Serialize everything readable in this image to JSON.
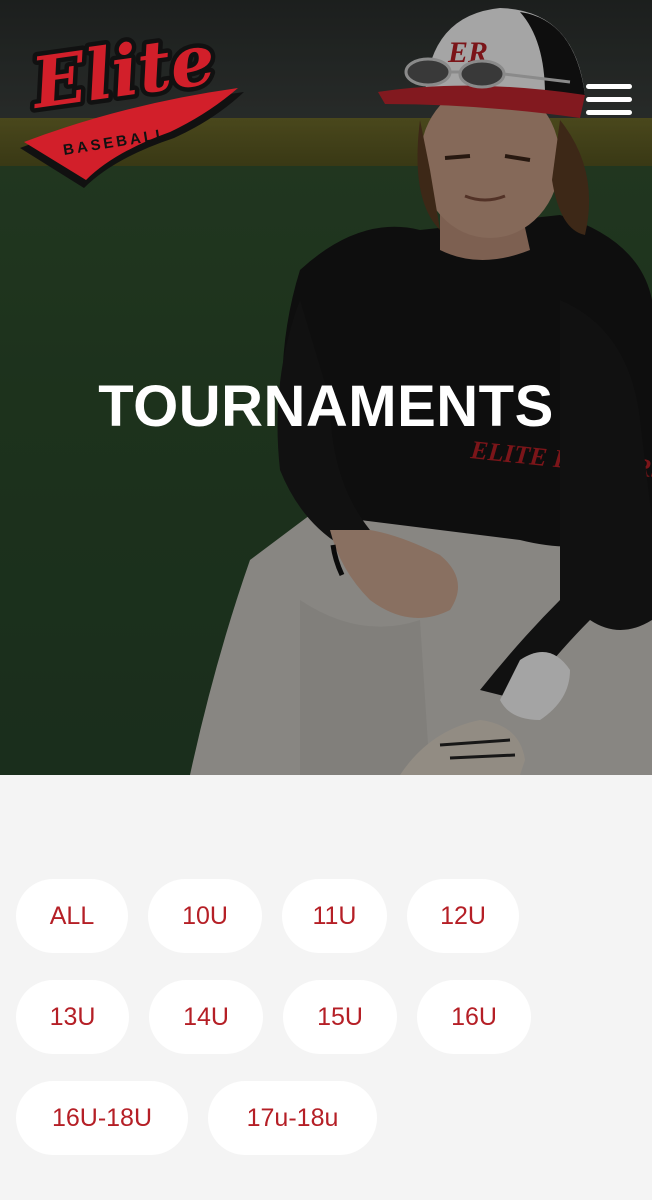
{
  "brand": {
    "logo_script": "Elite",
    "logo_banner": "BASEBALL",
    "cap_monogram": "ER",
    "colors": {
      "red": "#d21f2a",
      "dark_red": "#b51f26",
      "black": "#111111",
      "background": "#f4f4f4"
    }
  },
  "header": {
    "menu_icon": "hamburger-menu-icon"
  },
  "hero": {
    "title": "TOURNAMENTS"
  },
  "filters": {
    "items": [
      {
        "label": "ALL"
      },
      {
        "label": "10U"
      },
      {
        "label": "11U"
      },
      {
        "label": "12U"
      },
      {
        "label": "13U"
      },
      {
        "label": "14U"
      },
      {
        "label": "15U"
      },
      {
        "label": "16U"
      },
      {
        "label": "16U-18U"
      },
      {
        "label": "17u-18u"
      }
    ]
  }
}
